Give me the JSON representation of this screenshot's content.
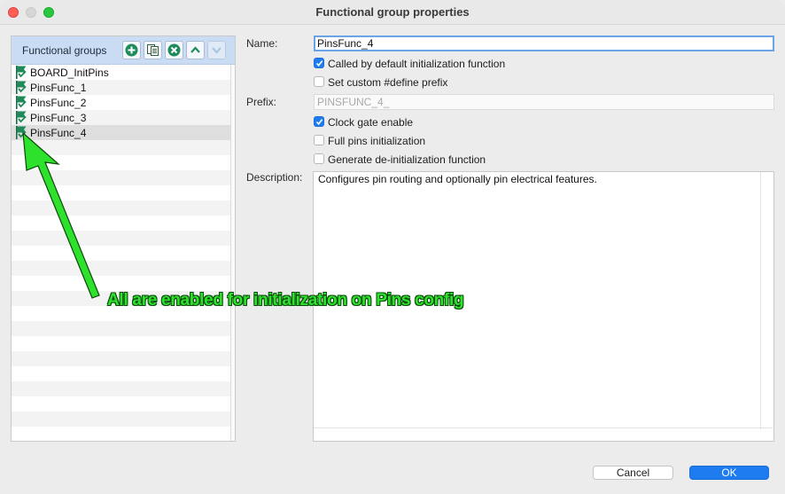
{
  "window": {
    "title": "Functional group properties"
  },
  "left_panel": {
    "title": "Functional groups",
    "toolbar_icons": [
      "add-icon",
      "copy-icon",
      "remove-icon",
      "move-up-icon",
      "move-down-icon"
    ],
    "items": [
      {
        "label": "BOARD_InitPins",
        "icon": "green-flag-check-icon"
      },
      {
        "label": "PinsFunc_1",
        "icon": "green-flag-check-icon"
      },
      {
        "label": "PinsFunc_2",
        "icon": "green-flag-check-icon"
      },
      {
        "label": "PinsFunc_3",
        "icon": "green-flag-check-icon"
      },
      {
        "label": "PinsFunc_4",
        "icon": "green-flag-check-icon",
        "selected": true
      }
    ]
  },
  "form": {
    "name_label": "Name:",
    "name_value": "PinsFunc_4",
    "called_by_default_label": "Called by default initialization function",
    "called_by_default_checked": true,
    "custom_prefix_label": "Set custom #define prefix",
    "custom_prefix_checked": false,
    "prefix_label": "Prefix:",
    "prefix_placeholder": "PINSFUNC_4_",
    "clock_gate_label": "Clock gate enable",
    "clock_gate_checked": true,
    "full_pins_label": "Full pins initialization",
    "full_pins_checked": false,
    "deinit_label": "Generate de-initialization function",
    "deinit_checked": false,
    "description_label": "Description:",
    "description_value": "Configures pin routing and optionally pin electrical features."
  },
  "buttons": {
    "cancel": "Cancel",
    "ok": "OK"
  },
  "annotation": {
    "text": "All are enabled for initialization on Pins config"
  },
  "colors": {
    "accent": "#1f7cf0",
    "panel_header": "#c9dcf3",
    "flag_green": "#1f8a5a",
    "annotation_green": "#2de12d"
  }
}
